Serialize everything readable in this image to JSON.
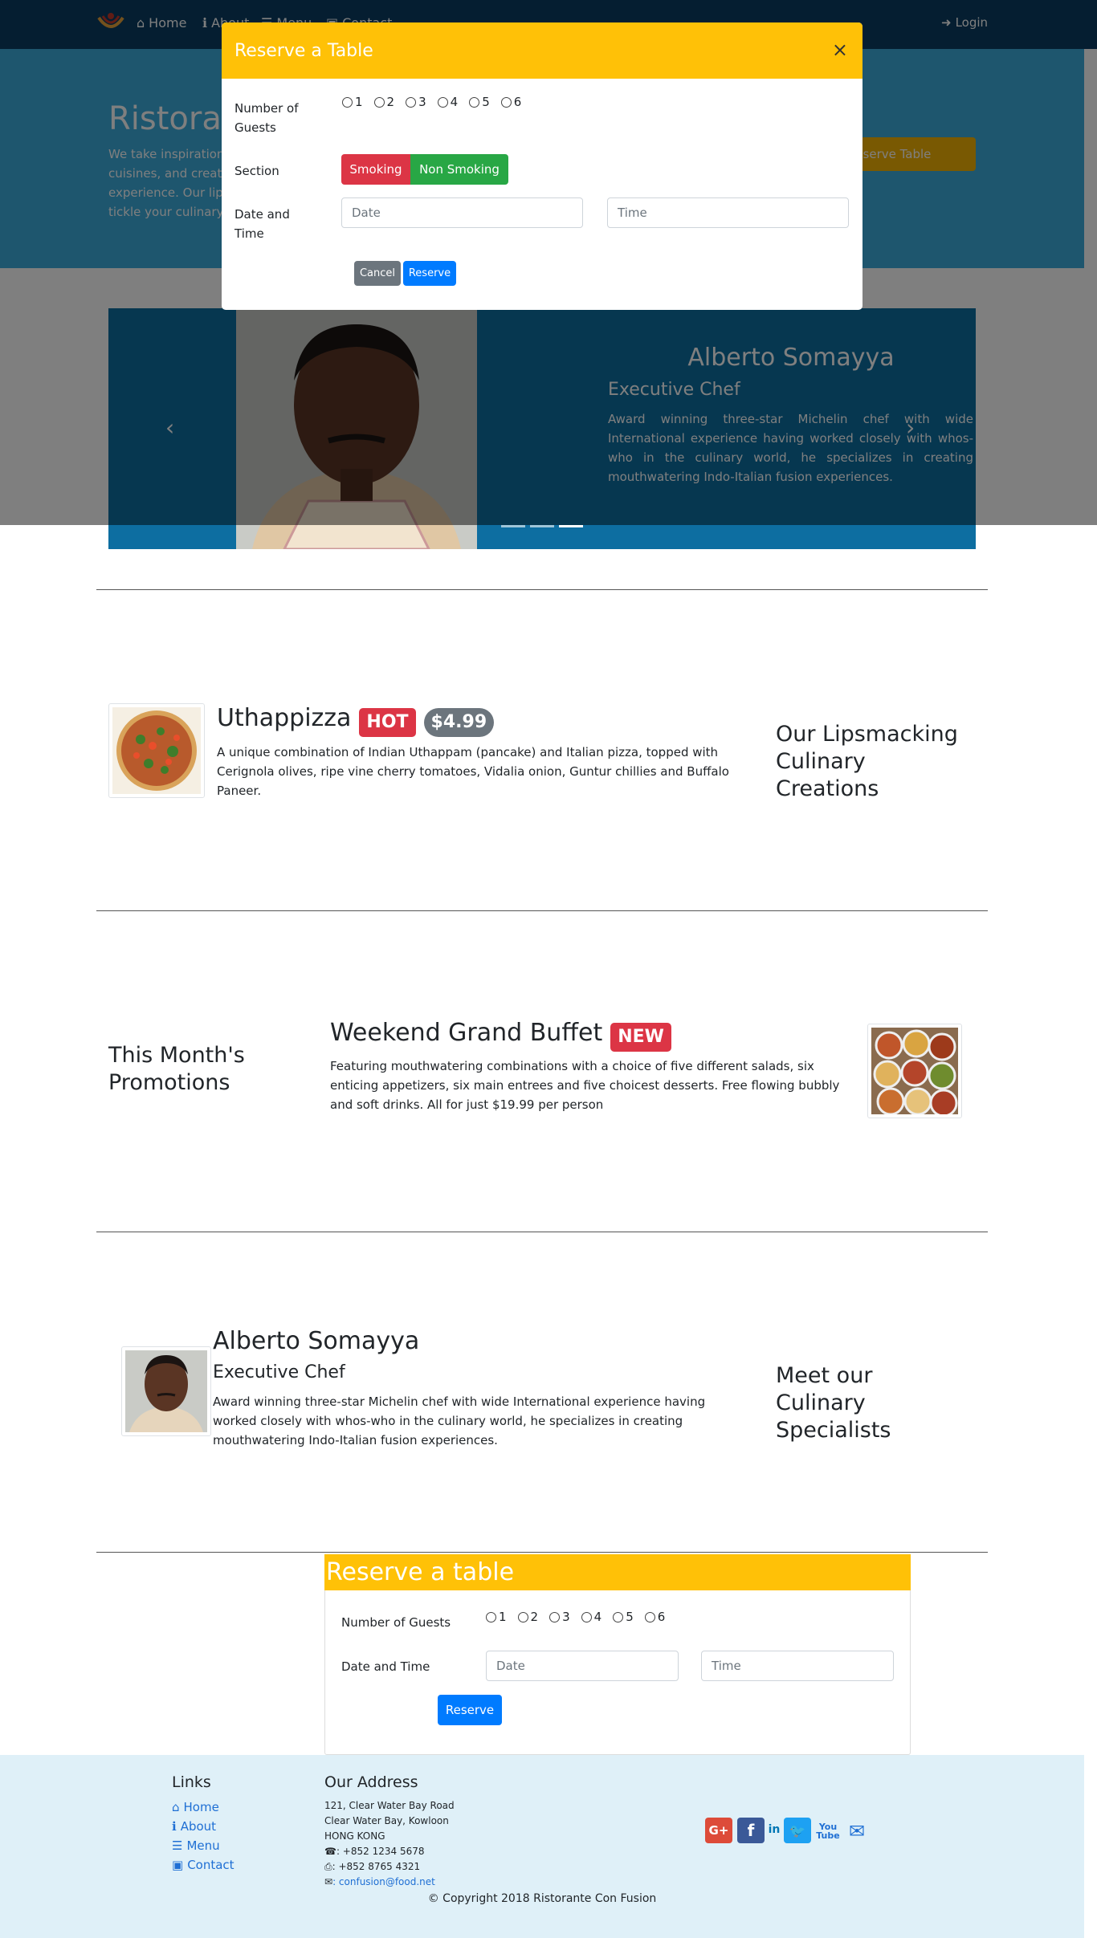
{
  "navbar": {
    "home": "Home",
    "about": "About",
    "menu": "Menu",
    "contact": "Contact",
    "login": "Login"
  },
  "jumbotron": {
    "title": "Ristorante con Fusion",
    "text": "We take inspiration from the World's best cuisines, and create a unique fusion experience. Our lipsmacking creations will tickle your culinary senses!",
    "button": "Reserve Table"
  },
  "carousel": {
    "name": "Alberto Somayya",
    "designation": "Executive Chef",
    "description": "Award winning three-star Michelin chef with wide International experience having worked closely with whos-who in the culinary world, he specializes in creating mouthwatering Indo-Italian fusion experiences."
  },
  "modal": {
    "title": "Reserve a Table",
    "close": "×",
    "guests_label": "Number of Guests",
    "guests": [
      "1",
      "2",
      "3",
      "4",
      "5",
      "6"
    ],
    "section_label": "Section",
    "smoking": "Smoking",
    "non_smoking": "Non Smoking",
    "datetime_label": "Date and Time",
    "date_placeholder": "Date",
    "time_placeholder": "Time",
    "cancel": "Cancel",
    "reserve": "Reserve"
  },
  "dish": {
    "name": "Uthappizza",
    "badge": "HOT",
    "price": "$4.99",
    "description": "A unique combination of Indian Uthappam (pancake) and Italian pizza, topped with Cerignola olives, ripe vine cherry tomatoes, Vidalia onion, Guntur chillies and Buffalo Paneer.",
    "heading": "Our Lipsmacking Culinary Creations"
  },
  "promotion": {
    "heading": "This Month's Promotions",
    "name": "Weekend Grand Buffet",
    "badge": "NEW",
    "description": "Featuring mouthwatering combinations with a choice of five different salads, six enticing appetizers, six main entrees and five choicest desserts. Free flowing bubbly and soft drinks. All for just $19.99 per person"
  },
  "leader": {
    "name": "Alberto Somayya",
    "designation": "Executive Chef",
    "description": "Award winning three-star Michelin chef with wide International experience having worked closely with whos-who in the culinary world, he specializes in creating mouthwatering Indo-Italian fusion experiences.",
    "heading": "Meet our Culinary Specialists"
  },
  "reserve_card": {
    "title": "Reserve a table",
    "guests_label": "Number of Guests",
    "guests": [
      "1",
      "2",
      "3",
      "4",
      "5",
      "6"
    ],
    "datetime_label": "Date and Time",
    "date_placeholder": "Date",
    "time_placeholder": "Time",
    "button": "Reserve"
  },
  "footer": {
    "links_heading": "Links",
    "links": [
      "Home",
      "About",
      "Menu",
      "Contact"
    ],
    "address_heading": "Our Address",
    "address": [
      "121, Clear Water Bay Road",
      "Clear Water Bay, Kowloon",
      "HONG KONG"
    ],
    "phone": ": +852 1234 5678",
    "fax": ": +852 8765 4321",
    "email": ": confusion@food.net",
    "copyright": "© Copyright 2018 Ristorante Con Fusion"
  },
  "colors": {
    "navbar": "#0a3d62",
    "jumbotron": "#3caddc",
    "modal_header": "#ffc107",
    "danger": "#dc3545",
    "success": "#28a745",
    "primary": "#007bff",
    "secondary": "#6c757d"
  }
}
